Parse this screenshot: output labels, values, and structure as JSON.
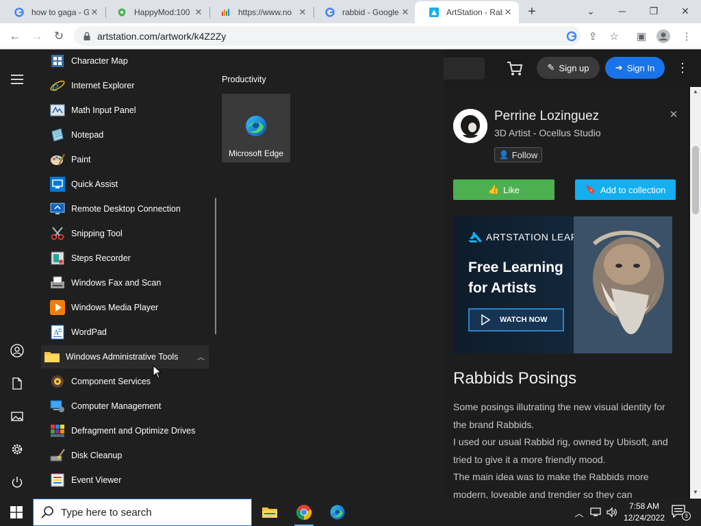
{
  "browser": {
    "tabs": [
      {
        "title": "how to gaga - G",
        "favicon": "google-icon"
      },
      {
        "title": "HappyMod:100",
        "favicon": "happymod-icon"
      },
      {
        "title": "https://www.no",
        "favicon": "chart-favicon-icon"
      },
      {
        "title": "rabbid - Google",
        "favicon": "google-icon"
      },
      {
        "title": "ArtStation - Rab",
        "favicon": "artstation-icon",
        "active": true
      }
    ],
    "url": "artstation.com/artwork/k4Z2Zy"
  },
  "artstation": {
    "header": {
      "signup_label": "Sign up",
      "signin_label": "Sign In"
    },
    "author": {
      "name": "Perrine Lozinguez",
      "role": "3D Artist - Ocellus Studio",
      "follow_label": "Follow"
    },
    "actions": {
      "like_label": "Like",
      "collection_label": "Add to collection"
    },
    "ad": {
      "brand": "ARTSTATION LEARNING",
      "headline_line1": "Free Learning",
      "headline_line2": "for Artists",
      "cta_label": "WATCH NOW"
    },
    "artwork": {
      "title": "Rabbids Posings",
      "description": [
        "Some posings illutrating the new visual identity for the brand Rabbids.",
        "I used our usual Rabbid rig, owned by Ubisoft, and tried to give it a more friendly mood.",
        "The main idea was to make the Rabbids more modern, loveable and trendier so they can"
      ]
    }
  },
  "start_menu": {
    "apps": [
      "Character Map",
      "Internet Explorer",
      "Math Input Panel",
      "Notepad",
      "Paint",
      "Quick Assist",
      "Remote Desktop Connection",
      "Snipping Tool",
      "Steps Recorder",
      "Windows Fax and Scan",
      "Windows Media Player",
      "WordPad"
    ],
    "folder": "Windows Administrative Tools",
    "admin_tools": [
      "Component Services",
      "Computer Management",
      "Defragment and Optimize Drives",
      "Disk Cleanup",
      "Event Viewer"
    ],
    "tiles_group": "Productivity",
    "tile_label": "Microsoft Edge"
  },
  "taskbar": {
    "search_placeholder": "Type here to search",
    "time": "7:58 AM",
    "date": "12/24/2022",
    "notification_count": "3"
  },
  "colors": {
    "accent_blue": "#1a73e8",
    "like_green": "#4caf50",
    "collection_blue": "#13aff0",
    "start_menu_bg": "#1f1f1f"
  }
}
